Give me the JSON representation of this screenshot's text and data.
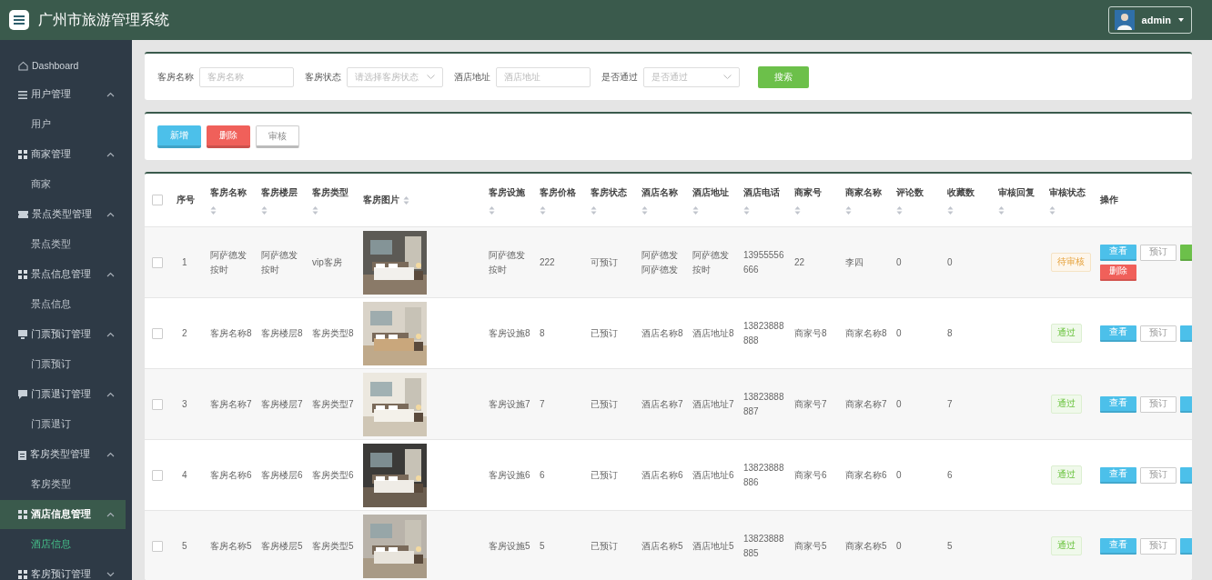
{
  "header": {
    "title": "广州市旅游管理系统",
    "user": "admin"
  },
  "sidebar": {
    "items": [
      {
        "label": "Dashboard",
        "kind": "home",
        "selected": false
      },
      {
        "label": "用户管理",
        "kind": "list",
        "expanded": true,
        "selected": false,
        "children": [
          {
            "label": "用户",
            "selected": false
          }
        ]
      },
      {
        "label": "商家管理",
        "kind": "grid",
        "expanded": true,
        "selected": false,
        "children": [
          {
            "label": "商家",
            "selected": false
          }
        ]
      },
      {
        "label": "景点类型管理",
        "kind": "ticket",
        "expanded": true,
        "selected": false,
        "children": [
          {
            "label": "景点类型",
            "selected": false
          }
        ]
      },
      {
        "label": "景点信息管理",
        "kind": "grid",
        "expanded": true,
        "selected": false,
        "children": [
          {
            "label": "景点信息",
            "selected": false
          }
        ]
      },
      {
        "label": "门票预订管理",
        "kind": "monitor",
        "expanded": true,
        "selected": false,
        "children": [
          {
            "label": "门票预订",
            "selected": false
          }
        ]
      },
      {
        "label": "门票退订管理",
        "kind": "chat",
        "expanded": true,
        "selected": false,
        "children": [
          {
            "label": "门票退订",
            "selected": false
          }
        ]
      },
      {
        "label": "客房类型管理",
        "kind": "clipboard",
        "expanded": true,
        "selected": false,
        "children": [
          {
            "label": "客房类型",
            "selected": false
          }
        ]
      },
      {
        "label": "酒店信息管理",
        "kind": "grid",
        "expanded": true,
        "selected": true,
        "children": [
          {
            "label": "酒店信息",
            "selected": true
          }
        ]
      },
      {
        "label": "客房预订管理",
        "kind": "grid",
        "expanded": false,
        "selected": false
      }
    ]
  },
  "search": {
    "fields": [
      {
        "label": "客房名称",
        "kind": "input",
        "placeholder": "客房名称"
      },
      {
        "label": "客房状态",
        "kind": "select",
        "placeholder": "请选择客房状态"
      },
      {
        "label": "酒店地址",
        "kind": "input",
        "placeholder": "酒店地址"
      },
      {
        "label": "是否通过",
        "kind": "select",
        "placeholder": "是否通过"
      }
    ],
    "button": "搜索"
  },
  "toolbar": [
    {
      "label": "新增",
      "kind": "add"
    },
    {
      "label": "删除",
      "kind": "delete"
    },
    {
      "label": "审核",
      "kind": "review"
    }
  ],
  "table": {
    "all_checked": false,
    "columns": [
      {
        "label": "序号",
        "sortable": false
      },
      {
        "label": "客房名称",
        "sortable": true
      },
      {
        "label": "客房楼层",
        "sortable": true
      },
      {
        "label": "客房类型",
        "sortable": true
      },
      {
        "label": "客房图片",
        "sortable": true
      },
      {
        "label": "客房设施",
        "sortable": true
      },
      {
        "label": "客房价格",
        "sortable": true
      },
      {
        "label": "客房状态",
        "sortable": true
      },
      {
        "label": "酒店名称",
        "sortable": true
      },
      {
        "label": "酒店地址",
        "sortable": true
      },
      {
        "label": "酒店电话",
        "sortable": true
      },
      {
        "label": "商家号",
        "sortable": true
      },
      {
        "label": "商家名称",
        "sortable": true
      },
      {
        "label": "评论数",
        "sortable": true
      },
      {
        "label": "收藏数",
        "sortable": true
      },
      {
        "label": "审核回复",
        "sortable": true
      },
      {
        "label": "审核状态",
        "sortable": true
      },
      {
        "label": "操作",
        "sortable": false
      }
    ],
    "rows": [
      {
        "checked": false,
        "cells": [
          "1",
          "阿萨德发按时",
          "阿萨德发按时",
          "vip客房",
          {
            "kind": "picture"
          },
          "阿萨德发按时",
          "222",
          "可预订",
          "阿萨德发阿萨德发",
          "阿萨德发按时",
          "13955556666",
          "22",
          "李四",
          "0",
          "0",
          ""
        ],
        "review": {
          "label": "待审核",
          "kind": "pending"
        },
        "actions": [
          {
            "label": "查看",
            "kind": "view"
          },
          {
            "label": "预订",
            "kind": "book"
          },
          {
            "kind": "green-cut"
          },
          {
            "label": "删除",
            "kind": "delete"
          }
        ]
      },
      {
        "checked": false,
        "cells": [
          "2",
          "客房名称8",
          "客房楼层8",
          "客房类型8",
          {
            "kind": "picture"
          },
          "客房设施8",
          "8",
          "已预订",
          "酒店名称8",
          "酒店地址8",
          "13823888888",
          "商家号8",
          "商家名称8",
          "0",
          "8",
          ""
        ],
        "review": {
          "label": "通过",
          "kind": "passed"
        },
        "actions": [
          {
            "label": "查看",
            "kind": "view"
          },
          {
            "label": "预订",
            "kind": "book"
          },
          {
            "kind": "blue-cut"
          }
        ]
      },
      {
        "checked": false,
        "cells": [
          "3",
          "客房名称7",
          "客房楼层7",
          "客房类型7",
          {
            "kind": "picture"
          },
          "客房设施7",
          "7",
          "已预订",
          "酒店名称7",
          "酒店地址7",
          "13823888887",
          "商家号7",
          "商家名称7",
          "0",
          "7",
          ""
        ],
        "review": {
          "label": "通过",
          "kind": "passed"
        },
        "actions": [
          {
            "label": "查看",
            "kind": "view"
          },
          {
            "label": "预订",
            "kind": "book"
          },
          {
            "kind": "blue-cut"
          }
        ]
      },
      {
        "checked": false,
        "cells": [
          "4",
          "客房名称6",
          "客房楼层6",
          "客房类型6",
          {
            "kind": "picture"
          },
          "客房设施6",
          "6",
          "已预订",
          "酒店名称6",
          "酒店地址6",
          "13823888886",
          "商家号6",
          "商家名称6",
          "0",
          "6",
          ""
        ],
        "review": {
          "label": "通过",
          "kind": "passed"
        },
        "actions": [
          {
            "label": "查看",
            "kind": "view"
          },
          {
            "label": "预订",
            "kind": "book"
          },
          {
            "kind": "blue-cut"
          }
        ]
      },
      {
        "checked": false,
        "cells": [
          "5",
          "客房名称5",
          "客房楼层5",
          "客房类型5",
          {
            "kind": "picture"
          },
          "客房设施5",
          "5",
          "已预订",
          "酒店名称5",
          "酒店地址5",
          "13823888885",
          "商家号5",
          "商家名称5",
          "0",
          "5",
          ""
        ],
        "review": {
          "label": "通过",
          "kind": "passed"
        },
        "actions": [
          {
            "label": "查看",
            "kind": "view"
          },
          {
            "label": "预订",
            "kind": "book"
          },
          {
            "kind": "blue-cut"
          }
        ]
      }
    ]
  }
}
